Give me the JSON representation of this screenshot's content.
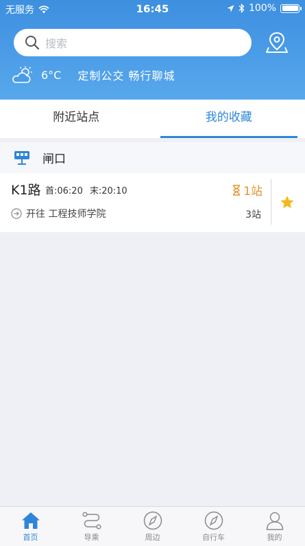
{
  "status": {
    "carrier": "无服务",
    "time": "16:45",
    "battery": "100%"
  },
  "search": {
    "placeholder": "搜索"
  },
  "weather": {
    "temperature": "6°C",
    "slogan": "定制公交 畅行聊城"
  },
  "tabs": [
    {
      "label": "附近站点"
    },
    {
      "label": "我的收藏",
      "active": true
    }
  ],
  "favorites": {
    "station": "闸口",
    "route": {
      "name": "K1路",
      "first": "首:06:20",
      "last": "末:20:10",
      "arrival": "1站",
      "direction": "开往 工程技师学院",
      "stops": "3站"
    }
  },
  "tabbar": [
    {
      "label": "首页",
      "icon": "home-icon",
      "active": true
    },
    {
      "label": "导乘",
      "icon": "route-icon"
    },
    {
      "label": "周边",
      "icon": "compass-icon"
    },
    {
      "label": "自行车",
      "icon": "compass-icon"
    },
    {
      "label": "我的",
      "icon": "user-icon"
    }
  ],
  "colors": {
    "primary": "#2f86d8",
    "header": "#4a9ce7",
    "arrival": "#e6922b",
    "star": "#f3b91b"
  }
}
